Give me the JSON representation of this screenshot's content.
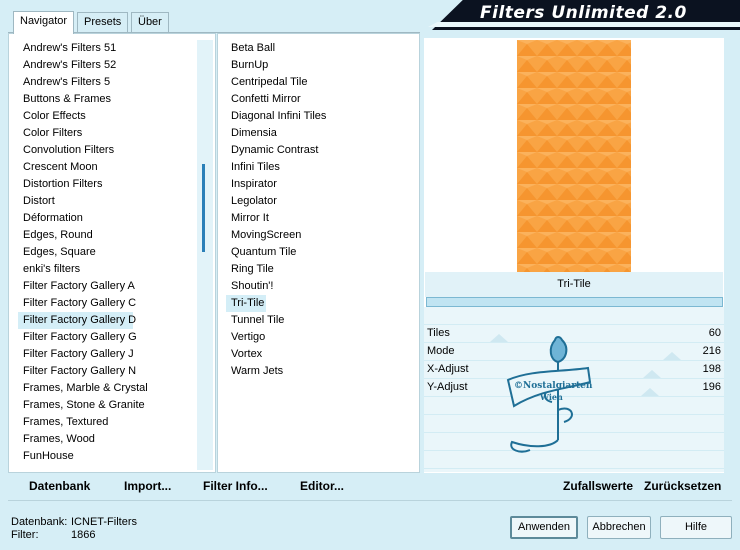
{
  "tabs": [
    "Navigator",
    "Presets",
    "Über"
  ],
  "brand": "Filters Unlimited 2.0",
  "categories": [
    "Andrew's Filters 51",
    "Andrew's Filters 52",
    "Andrew's Filters 5",
    "Buttons & Frames",
    "Color Effects",
    "Color Filters",
    "Convolution Filters",
    "Crescent Moon",
    "Distortion Filters",
    "Distort",
    "Déformation",
    "Edges, Round",
    "Edges, Square",
    "enki's filters",
    "Filter Factory Gallery A",
    "Filter Factory Gallery C",
    "Filter Factory Gallery D",
    "Filter Factory Gallery G",
    "Filter Factory Gallery J",
    "Filter Factory Gallery N",
    "Frames, Marble & Crystal",
    "Frames, Stone & Granite",
    "Frames, Textured",
    "Frames, Wood",
    "FunHouse"
  ],
  "selected_category": "Filter Factory Gallery D",
  "filters": [
    "Beta Ball",
    "BurnUp",
    "Centripedal Tile",
    "Confetti Mirror",
    "Diagonal Infini Tiles",
    "Dimensia",
    "Dynamic Contrast",
    "Infini Tiles",
    "Inspirator",
    "Legolator",
    "Mirror It",
    "MovingScreen",
    "Quantum Tile",
    "Ring Tile",
    "Shoutin'!",
    "Tri-Tile",
    "Tunnel Tile",
    "Vertigo",
    "Vortex",
    "Warm Jets"
  ],
  "selected_filter": "Tri-Tile",
  "preview_title": "Tri-Tile",
  "params": [
    {
      "label": "Tiles",
      "value": "60",
      "level": 0.235
    },
    {
      "label": "Mode",
      "value": "216",
      "level": 0.847
    },
    {
      "label": "X-Adjust",
      "value": "198",
      "level": 0.776
    },
    {
      "label": "Y-Adjust",
      "value": "196",
      "level": 0.769
    }
  ],
  "bottom_left": {
    "datenbank": "Datenbank",
    "import": "Import...",
    "filter_info": "Filter Info...",
    "editor": "Editor..."
  },
  "bottom_right": {
    "zufall": "Zufallswerte",
    "reset": "Zurücksetzen"
  },
  "info": {
    "db_label": "Datenbank:",
    "db_value": "ICNET-Filters",
    "filter_label": "Filter:",
    "filter_value": "1866"
  },
  "buttons": {
    "apply": "Anwenden",
    "cancel": "Abbrechen",
    "help": "Hilfe"
  },
  "watermark": {
    "line1": "©Nostalgiarten",
    "line2": "Wien"
  },
  "colors": {
    "preview": "#f9a444",
    "accent": "#2a7fb8",
    "background": "#d6eef6"
  }
}
